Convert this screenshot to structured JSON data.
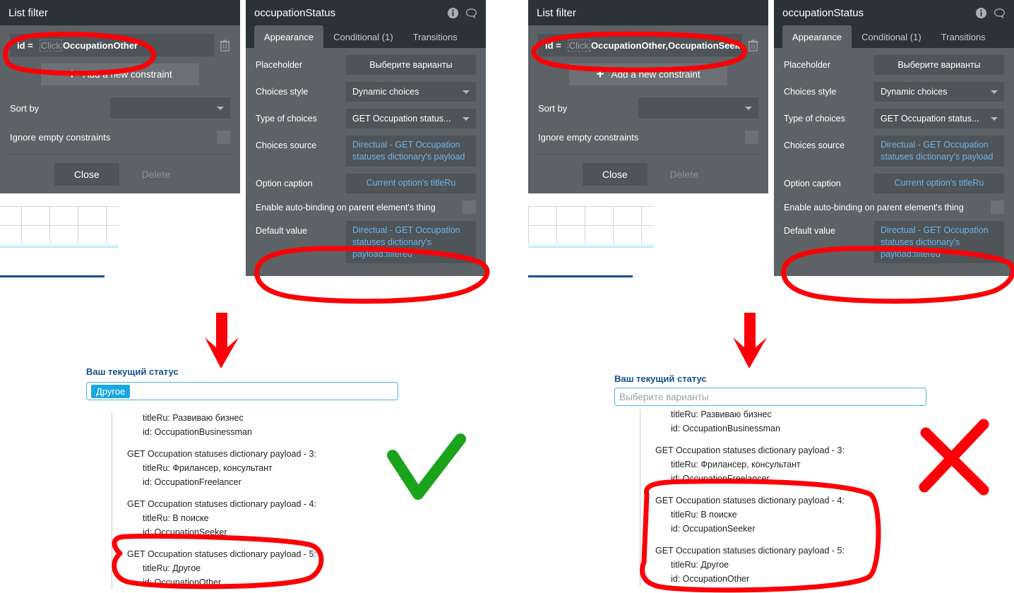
{
  "panels": {
    "list_filter_left": {
      "title": "List filter",
      "constraint": {
        "key": "id =",
        "placeholder": "Click",
        "value": "OccupationOther"
      },
      "add_constraint_label": "Add a new constraint",
      "sort_by_label": "Sort by",
      "sort_by_value": "",
      "ignore_empty_label": "Ignore empty constraints",
      "close_label": "Close",
      "delete_label": "Delete"
    },
    "list_filter_right": {
      "title": "List filter",
      "constraint": {
        "key": "id =",
        "placeholder": "Click",
        "value": "OccupationOther,OccupationSeeker"
      },
      "add_constraint_label": "Add a new constraint",
      "sort_by_label": "Sort by",
      "sort_by_value": "",
      "ignore_empty_label": "Ignore empty constraints",
      "close_label": "Close",
      "delete_label": "Delete"
    },
    "occupation_left": {
      "title": "occupationStatus",
      "tabs": [
        {
          "label": "Appearance",
          "active": true
        },
        {
          "label": "Conditional (1)",
          "active": false
        },
        {
          "label": "Transitions",
          "active": false
        }
      ],
      "props": {
        "placeholder_label": "Placeholder",
        "placeholder_value": "Выберите варианты",
        "choices_style_label": "Choices style",
        "choices_style_value": "Dynamic choices",
        "type_of_choices_label": "Type of choices",
        "type_of_choices_value": "GET Occupation status...",
        "choices_source_label": "Choices source",
        "choices_source_value": "Directual - GET Occupation statuses dictionary's payload",
        "option_caption_label": "Option caption",
        "option_caption_value": "Current option's titleRu",
        "auto_binding_label": "Enable auto-binding on parent element's thing",
        "default_value_label": "Default value",
        "default_value_value": "Directual - GET Occupation statuses dictionary's payload:filtered"
      }
    },
    "occupation_right": {
      "title": "occupationStatus",
      "tabs": [
        {
          "label": "Appearance",
          "active": true
        },
        {
          "label": "Conditional (1)",
          "active": false
        },
        {
          "label": "Transitions",
          "active": false
        }
      ],
      "props": {
        "placeholder_label": "Placeholder",
        "placeholder_value": "Выберите варианты",
        "choices_style_label": "Choices style",
        "choices_style_value": "Dynamic choices",
        "type_of_choices_label": "Type of choices",
        "type_of_choices_value": "GET Occupation status...",
        "choices_source_label": "Choices source",
        "choices_source_value": "Directual - GET Occupation statuses dictionary's payload",
        "option_caption_label": "Option caption",
        "option_caption_value": "Current option's titleRu",
        "auto_binding_label": "Enable auto-binding on parent element's thing",
        "default_value_label": "Default value",
        "default_value_value": "Directual - GET Occupation statuses dictionary's payload:filtered"
      }
    }
  },
  "preview_left": {
    "field_label": "Ваш текущий статус",
    "selected_chip": "Другое",
    "tree": [
      {
        "indent": 2,
        "text": "titleRu:   Развиваю бизнес"
      },
      {
        "indent": 2,
        "text": "id:   OccupationBusinessman"
      },
      {
        "indent": 1,
        "text": "GET Occupation statuses dictionary payload - 3:"
      },
      {
        "indent": 2,
        "text": "titleRu:   Фрилансер, консультант"
      },
      {
        "indent": 2,
        "text": "id:   OccupationFreelancer"
      },
      {
        "indent": 1,
        "text": "GET Occupation statuses dictionary payload - 4:"
      },
      {
        "indent": 2,
        "text": "titleRu:   В поиске"
      },
      {
        "indent": 2,
        "text": "id:   OccupationSeeker"
      },
      {
        "indent": 1,
        "text": "GET Occupation statuses dictionary payload - 5:"
      },
      {
        "indent": 2,
        "text": "titleRu:   Другое"
      },
      {
        "indent": 2,
        "text": "id:   OccupationOther"
      }
    ],
    "verdict": "check"
  },
  "preview_right": {
    "field_label": "Ваш текущий статус",
    "placeholder": "Выберите варианты",
    "tree": [
      {
        "indent": 2,
        "text": "titleRu:   Развиваю бизнес"
      },
      {
        "indent": 2,
        "text": "id:   OccupationBusinessman"
      },
      {
        "indent": 1,
        "text": "GET Occupation statuses dictionary payload - 3:"
      },
      {
        "indent": 2,
        "text": "titleRu:   Фрилансер, консультант"
      },
      {
        "indent": 2,
        "text": "id:   OccupationFreelancer"
      },
      {
        "indent": 1,
        "text": "GET Occupation statuses dictionary payload - 4:"
      },
      {
        "indent": 2,
        "text": "titleRu:   В поиске"
      },
      {
        "indent": 2,
        "text": "id:   OccupationSeeker"
      },
      {
        "indent": 1,
        "text": "GET Occupation statuses dictionary payload - 5:"
      },
      {
        "indent": 2,
        "text": "titleRu:   Другое"
      },
      {
        "indent": 2,
        "text": "id:   OccupationOther"
      }
    ],
    "verdict": "cross"
  },
  "colors": {
    "panel_header": "#2b3338",
    "panel_body": "#5c6265",
    "field": "#4e5457",
    "link": "#6fb3ec",
    "annotation_red": "#fb0007",
    "annotation_green": "#1ba31b",
    "chip_blue": "#19a7e0",
    "label_blue": "#15508f"
  }
}
